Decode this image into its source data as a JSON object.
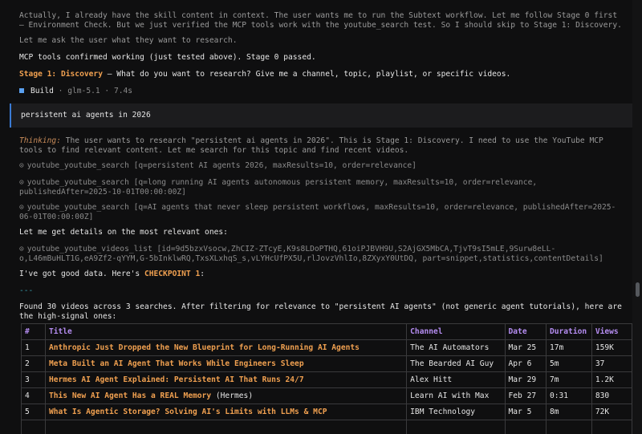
{
  "transcript": {
    "l1": "Actually, I already have the skill content in context. The user wants me to run the Subtext workflow. Let me follow Stage 0 first – Environment Check. But we just verified the MCP tools work with the youtube_search test. So I should skip to Stage 1: Discovery.",
    "l2": "Let me ask the user what they want to research.",
    "l3": "MCP tools confirmed working (just tested above). Stage 0 passed.",
    "stage_label": "Stage 1: Discovery",
    "stage_rest": " – What do you want to research? Give me a channel, topic, playlist, or specific videos.",
    "build_label": "Build",
    "build_meta": " · glm-5.1 · 7.4s",
    "user_message": "persistent ai agents in 2026",
    "thinking_label": "Thinking:",
    "thinking_text": " The user wants to research \"persistent ai agents in 2026\". This is Stage 1: Discovery. I need to use the YouTube MCP tools to find relevant content. Let me search for this topic and find recent videos.",
    "tool1": "youtube_youtube_search [q=persistent AI agents 2026, maxResults=10, order=relevance]",
    "tool2": "youtube_youtube_search [q=long running AI agents autonomous persistent memory, maxResults=10, order=relevance, publishedAfter=2025-10-01T00:00:00Z]",
    "tool3": "youtube_youtube_search [q=AI agents that never sleep persistent workflows, maxResults=10, order=relevance, publishedAfter=2025-06-01T00:00:00Z]",
    "l4": "Let me get details on the most relevant ones:",
    "tool4": "youtube_youtube_videos_list [id=9d5bzxVsocw,ZhCIZ-ZTcyE,K9s8LDoPTHQ,61oiPJBVH9U,S2AjGX5MbCA,TjvT9sI5mLE,9Surw8eLL-o,L46mBuHLT1G,eA9Zf2-qYYM,G-5bInklwRQ,TxsXLxhqS_s,vLYHcUfPX5U,rlJovzVhlIo,8ZXyxY0UtDQ, part=snippet,statistics,contentDetails]",
    "l5_pre": "I've got good data. Here's ",
    "l5_checkpoint": "CHECKPOINT 1",
    "l5_post": ":",
    "separator": "---",
    "l6": "Found 30 videos across 3 searches. After filtering for relevance to \"persistent AI agents\" (not generic agent tutorials), here are the high-signal ones:",
    "bullet": "⊙"
  },
  "table": {
    "headers": [
      "#",
      "Title",
      "Channel",
      "Date",
      "Duration",
      "Views"
    ],
    "rows": [
      {
        "n": "1",
        "title": "Anthropic Just Dropped the New Blueprint for Long-Running AI Agents",
        "suffix": "",
        "channel": "The AI Automators",
        "date": "Mar 25",
        "duration": "17m",
        "views": "159K"
      },
      {
        "n": "2",
        "title": "Meta Built an AI Agent That Works While Engineers Sleep",
        "suffix": "",
        "channel": "The Bearded AI Guy",
        "date": "Apr 6",
        "duration": "5m",
        "views": "37"
      },
      {
        "n": "3",
        "title": "Hermes AI Agent Explained: Persistent AI That Runs 24/7",
        "suffix": "",
        "channel": "Alex Hitt",
        "date": "Mar 29",
        "duration": "7m",
        "views": "1.2K"
      },
      {
        "n": "4",
        "title": "This New AI Agent Has a REAL Memory",
        "suffix": " (Hermes)",
        "channel": "Learn AI with Max",
        "date": "Feb 27",
        "duration": "0:31",
        "views": "830"
      },
      {
        "n": "5",
        "title": "What Is Agentic Storage? Solving AI's Limits with LLMs & MCP",
        "suffix": "",
        "channel": "IBM Technology",
        "date": "Mar 5",
        "duration": "8m",
        "views": "72K"
      }
    ]
  }
}
